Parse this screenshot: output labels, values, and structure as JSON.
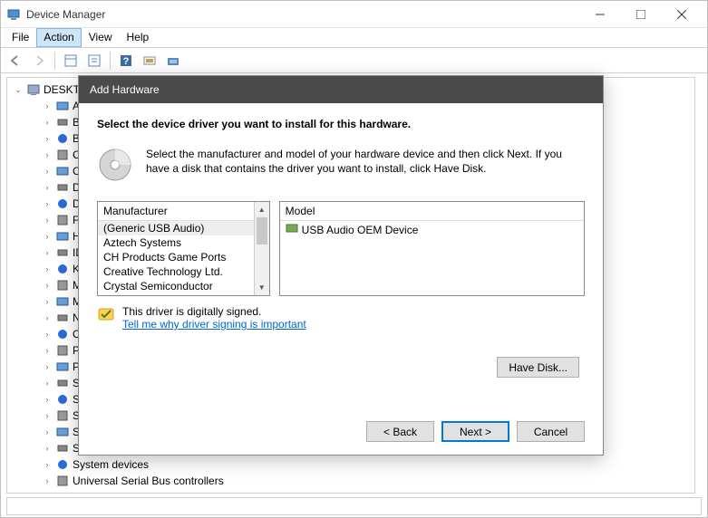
{
  "window": {
    "title": "Device Manager",
    "menus": [
      "File",
      "Action",
      "View",
      "Help"
    ],
    "active_menu_index": 1
  },
  "tree": {
    "root": "DESKTOP",
    "nodes": [
      "Audio",
      "Batteries",
      "Bluetooth",
      "Cameras",
      "Computer",
      "Disk drives",
      "Display adapters",
      "Firmware",
      "Human Interface Devices",
      "IDE ATA/ATAPI controllers",
      "Keyboards",
      "Mice and other pointing devices",
      "Monitors",
      "Network adapters",
      "Other devices",
      "Print queues",
      "Processors",
      "Security devices",
      "Software components",
      "Software devices",
      "Sound, video and game controllers",
      "Storage controllers",
      "System devices",
      "Universal Serial Bus controllers"
    ]
  },
  "dialog": {
    "title": "Add Hardware",
    "heading": "Select the device driver you want to install for this hardware.",
    "instruction": "Select the manufacturer and model of your hardware device and then click Next. If you have a disk that contains the driver you want to install, click Have Disk.",
    "manufacturer_label": "Manufacturer",
    "model_label": "Model",
    "manufacturers": [
      "(Generic USB Audio)",
      "Aztech Systems",
      "CH Products Game Ports",
      "Creative Technology Ltd.",
      "Crystal Semiconductor"
    ],
    "selected_manufacturer_index": 0,
    "models": [
      "USB Audio OEM Device"
    ],
    "signed_text": "This driver is digitally signed.",
    "signed_link": "Tell me why driver signing is important",
    "have_disk_label": "Have Disk...",
    "back_label": "< Back",
    "next_label": "Next >",
    "cancel_label": "Cancel"
  }
}
